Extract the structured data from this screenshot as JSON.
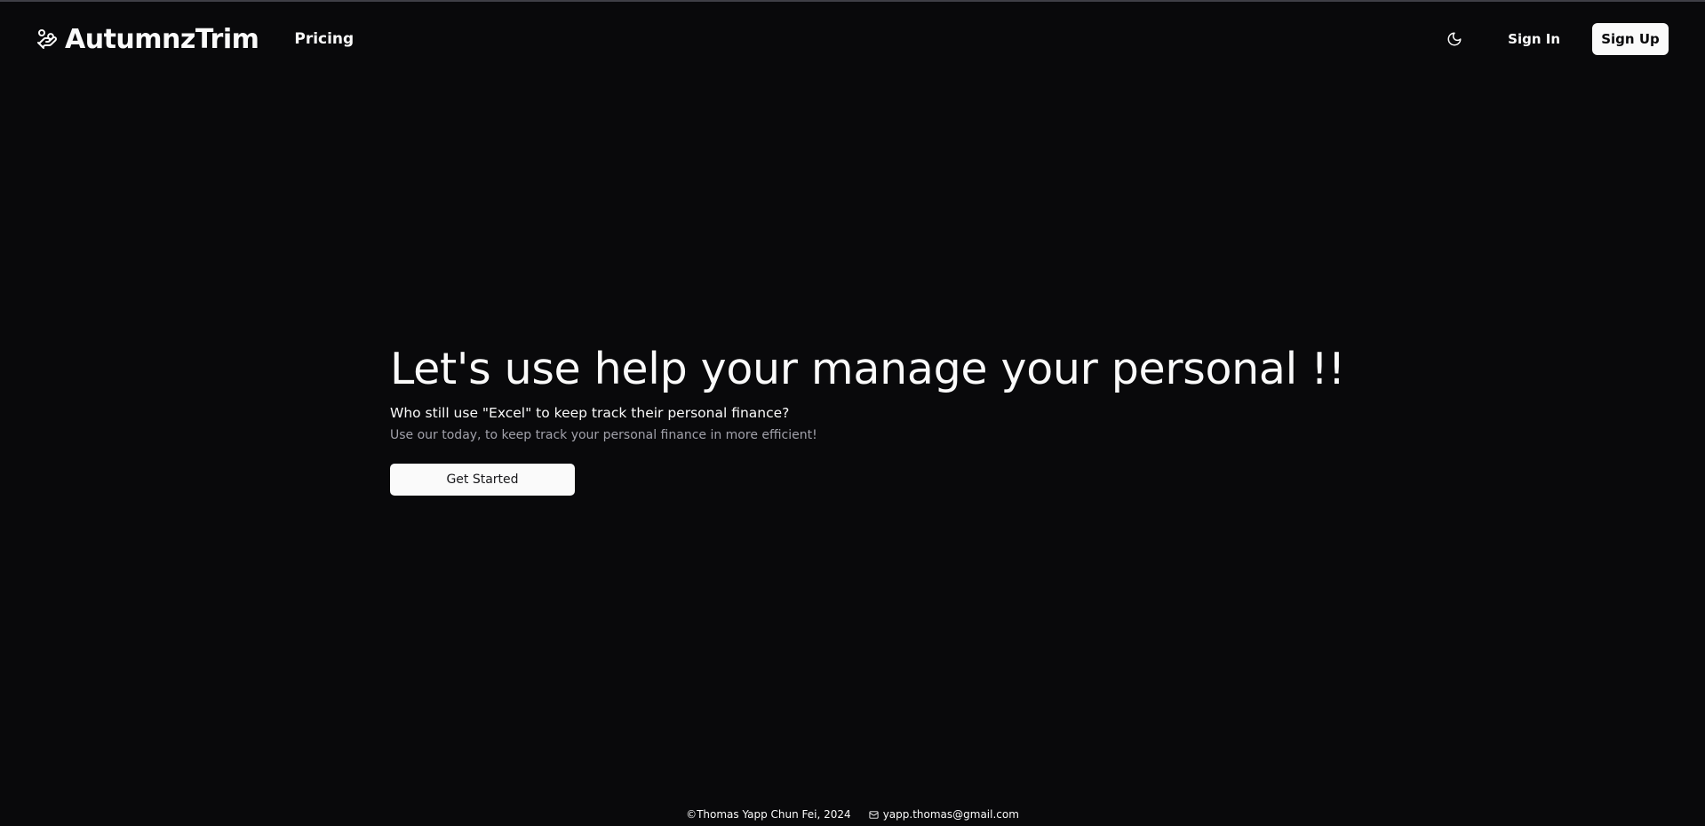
{
  "header": {
    "brand_name": "AutumnzTrim",
    "brand_icon": "hand-coins-icon",
    "nav": [
      {
        "label": "Pricing"
      }
    ],
    "theme_toggle_icon": "moon-icon",
    "signin_label": "Sign In",
    "signup_label": "Sign Up"
  },
  "hero": {
    "title": "Let's use help your manage your personal !!",
    "subtitle": "Who still use \"Excel\" to keep track their personal finance?",
    "description": "Use our today, to keep track your personal finance in more efficient!",
    "cta_label": "Get Started"
  },
  "footer": {
    "copyright": "©Thomas Yapp Chun Fei, 2024",
    "email_icon": "mail-icon",
    "email": "yapp.thomas@gmail.com"
  },
  "colors": {
    "background": "#09090b",
    "foreground": "#fafafa",
    "muted": "#a1a1aa"
  }
}
